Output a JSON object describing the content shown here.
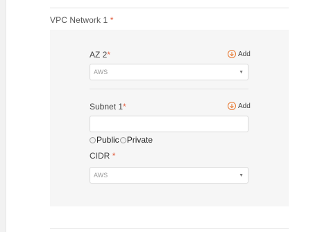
{
  "section": {
    "title": "VPC Network 1",
    "required_mark": "*"
  },
  "az": {
    "label": "AZ 2",
    "required_mark": "*",
    "add_label": "Add",
    "select_value": "AWS",
    "caret": "▼"
  },
  "subnet": {
    "label": "Subnet 1",
    "required_mark": "*",
    "add_label": "Add",
    "input_value": ""
  },
  "visibility": {
    "options": [
      "Public",
      "Private"
    ]
  },
  "cidr": {
    "label": "CIDR",
    "required_mark": "*",
    "select_value": "AWS",
    "caret": "▼"
  },
  "icons": {
    "add": "plus-circle-icon",
    "radio": "radio-unchecked-icon",
    "dropdown": "chevron-down-icon"
  },
  "colors": {
    "accent": "#e8772e",
    "required": "#e05a3a",
    "panel_bg": "#f6f6f6"
  }
}
